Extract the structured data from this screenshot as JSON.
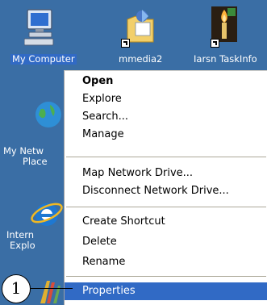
{
  "desktop": {
    "icons": [
      {
        "label": "My Computer"
      },
      {
        "label": "mmedia2"
      },
      {
        "label": "Iarsn TaskInfo"
      },
      {
        "label": "My Netw"
      },
      {
        "label": "Place"
      },
      {
        "label": "Intern"
      },
      {
        "label": "Explo"
      }
    ]
  },
  "context_menu": {
    "items": [
      {
        "label": "Open"
      },
      {
        "label": "Explore"
      },
      {
        "label": "Search..."
      },
      {
        "label": "Manage"
      },
      {
        "label": "Map Network Drive..."
      },
      {
        "label": "Disconnect Network Drive..."
      },
      {
        "label": "Create Shortcut"
      },
      {
        "label": "Delete"
      },
      {
        "label": "Rename"
      },
      {
        "label": "Properties"
      }
    ]
  },
  "callout": {
    "number": "1"
  },
  "colors": {
    "desktop_bg": "#3a6ea5",
    "selection": "#316ac5",
    "menu_bg": "#ffffff"
  }
}
